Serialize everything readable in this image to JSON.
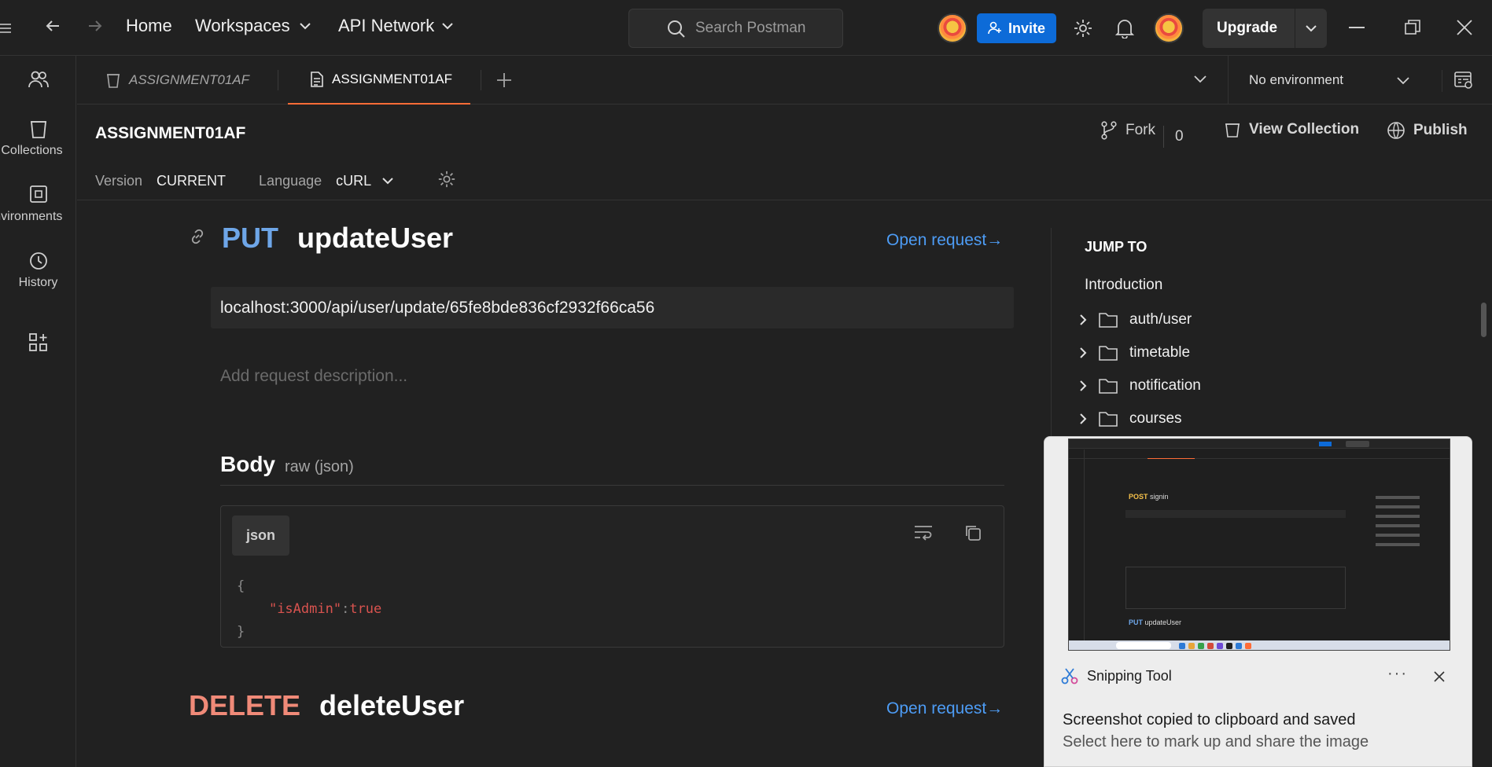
{
  "topbar": {
    "home": "Home",
    "workspaces": "Workspaces",
    "api_network": "API Network",
    "search_placeholder": "Search Postman",
    "invite": "Invite",
    "upgrade": "Upgrade"
  },
  "sidebar": {
    "items": [
      {
        "label": "Collections",
        "icon": "collections-icon"
      },
      {
        "label": "Environments",
        "icon": "environments-icon"
      },
      {
        "label": "History",
        "icon": "history-icon"
      }
    ]
  },
  "tabs": [
    {
      "label": "ASSIGNMENT01AF",
      "icon": "collection-icon",
      "active": false
    },
    {
      "label": "ASSIGNMENT01AF",
      "icon": "document-icon",
      "active": true
    }
  ],
  "environment": {
    "selected": "No environment"
  },
  "doc": {
    "title": "ASSIGNMENT01AF",
    "fork_label": "Fork",
    "fork_count": "0",
    "view_collection": "View Collection",
    "publish": "Publish",
    "version_label": "Version",
    "version_value": "CURRENT",
    "language_label": "Language",
    "language_value": "cURL"
  },
  "requests": [
    {
      "method": "PUT",
      "name": "updateUser",
      "open_request": "Open request→",
      "url": "localhost:3000/api/user/update/65fe8bde836cf2932f66ca56",
      "description_placeholder": "Add request description...",
      "body_title": "Body",
      "body_type": "raw (json)",
      "code_lang": "json",
      "code_open": "{",
      "code_key": "\"isAdmin\"",
      "code_colon": ":",
      "code_value": "true",
      "code_close": "}"
    },
    {
      "method": "DELETE",
      "name": "deleteUser",
      "open_request": "Open request→"
    }
  ],
  "jump_to": {
    "title": "JUMP TO",
    "intro": "Introduction",
    "folders": [
      "auth/user",
      "timetable",
      "notification",
      "courses"
    ]
  },
  "toast": {
    "app_name": "Snipping Tool",
    "more": "···",
    "message": "Screenshot copied to clipboard and saved",
    "sub": "Select here to mark up and share the image",
    "thumb": {
      "method": "POST",
      "name": "signin",
      "method2": "PUT",
      "name2": "updateUser"
    }
  },
  "colors": {
    "accent_orange": "#ff6c37",
    "invite_blue": "#0d6bd8",
    "put_blue": "#6ea6e8",
    "delete_red": "#f08a78",
    "link_blue": "#4d9cf5"
  }
}
